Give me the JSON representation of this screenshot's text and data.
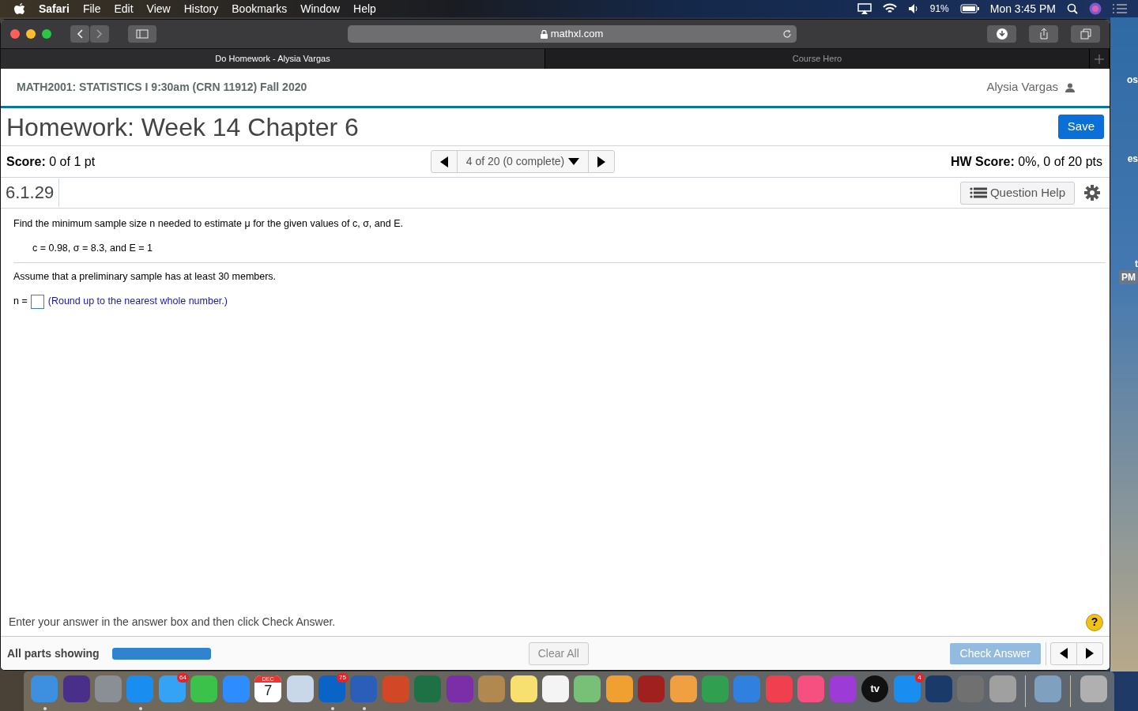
{
  "menu_bar": {
    "app": "Safari",
    "menus": [
      "File",
      "Edit",
      "View",
      "History",
      "Bookmarks",
      "Window",
      "Help"
    ],
    "battery": "91%",
    "clock": "Mon 3:45 PM"
  },
  "browser": {
    "url": "mathxl.com",
    "tabs": [
      {
        "label": "Do Homework - Alysia Vargas",
        "selected": true
      },
      {
        "label": "Course Hero",
        "selected": false
      }
    ]
  },
  "page": {
    "course": "MATH2001: STATISTICS I 9:30am (CRN 11912) Fall 2020",
    "user": "Alysia Vargas",
    "title": "Homework: Week 14 Chapter 6",
    "save_button": "Save",
    "score_label": "Score:",
    "score_value": "0 of 1 pt",
    "question_nav": "4 of 20 (0 complete)",
    "hw_score_label": "HW Score:",
    "hw_score_value": "0%, 0 of 20 pts",
    "question_number": "6.1.29",
    "help_button": "Question Help",
    "question": {
      "prompt": "Find the minimum sample size n needed to estimate μ for the given values of c, σ, and E.",
      "givens": "c = 0.98, σ = 8.3, and E = 1",
      "assumption": "Assume that a preliminary sample has at least 30 members.",
      "answer_label": "n =",
      "hint": "(Round up to the nearest whole number.)"
    },
    "help_symbol": "?",
    "instruction": "Enter your answer in the answer box and then click Check Answer.",
    "parts_label": "All parts showing",
    "parts_progress": {
      "level": 1
    },
    "clear_button": "Clear All",
    "check_button": {
      "label": "Check Answer",
      "disabled": true
    }
  },
  "desktop_labels": [
    "os",
    "es",
    "t",
    "PM"
  ],
  "dock": [
    {
      "kind": "app",
      "color": "#3d8fe0",
      "running": true
    },
    {
      "kind": "app",
      "color": "#4a2f8a",
      "running": false
    },
    {
      "kind": "app",
      "color": "#8a8f96",
      "running": false
    },
    {
      "kind": "app",
      "color": "#1a8ef0",
      "running": true
    },
    {
      "kind": "app",
      "color": "#35a3f5",
      "running": false,
      "badge": "64"
    },
    {
      "kind": "app",
      "color": "#3bc24a",
      "running": false
    },
    {
      "kind": "app",
      "color": "#2d8cff",
      "running": false
    },
    {
      "kind": "calendar",
      "color": "#ffffff",
      "running": false,
      "month": "DEC",
      "day": "7"
    },
    {
      "kind": "app",
      "color": "#c8d8e8",
      "running": false
    },
    {
      "kind": "app",
      "color": "#0a64c8",
      "running": true,
      "badge": "75"
    },
    {
      "kind": "app",
      "color": "#2b5eb8",
      "running": true
    },
    {
      "kind": "app",
      "color": "#d24726",
      "running": false
    },
    {
      "kind": "app",
      "color": "#1e7145",
      "running": false
    },
    {
      "kind": "app",
      "color": "#7b2ea8",
      "running": false
    },
    {
      "kind": "app",
      "color": "#b08850",
      "running": false
    },
    {
      "kind": "app",
      "color": "#f8e070",
      "running": false
    },
    {
      "kind": "app",
      "color": "#f4f4f4",
      "running": false
    },
    {
      "kind": "app",
      "color": "#78c078",
      "running": false
    },
    {
      "kind": "app",
      "color": "#f0a030",
      "running": false
    },
    {
      "kind": "app",
      "color": "#a02020",
      "running": false
    },
    {
      "kind": "app",
      "color": "#f0a040",
      "running": false
    },
    {
      "kind": "app",
      "color": "#30a050",
      "running": false
    },
    {
      "kind": "app",
      "color": "#3080e0",
      "running": false
    },
    {
      "kind": "app",
      "color": "#f04050",
      "running": false
    },
    {
      "kind": "app",
      "color": "#f55080",
      "running": false
    },
    {
      "kind": "app",
      "color": "#9c3bd6",
      "running": false
    },
    {
      "kind": "tv",
      "color": "#111111",
      "running": false,
      "label": "tv"
    },
    {
      "kind": "app",
      "color": "#1a8ef0",
      "running": false,
      "badge": "4"
    },
    {
      "kind": "app",
      "color": "#1a3a6a",
      "running": false
    },
    {
      "kind": "app",
      "color": "#707070",
      "running": false
    },
    {
      "kind": "app",
      "color": "#a0a0a0",
      "running": false
    },
    {
      "kind": "separator"
    },
    {
      "kind": "app",
      "color": "#80a0c0",
      "running": false
    },
    {
      "kind": "separator"
    },
    {
      "kind": "app",
      "color": "#b0b0b0",
      "running": false
    }
  ]
}
